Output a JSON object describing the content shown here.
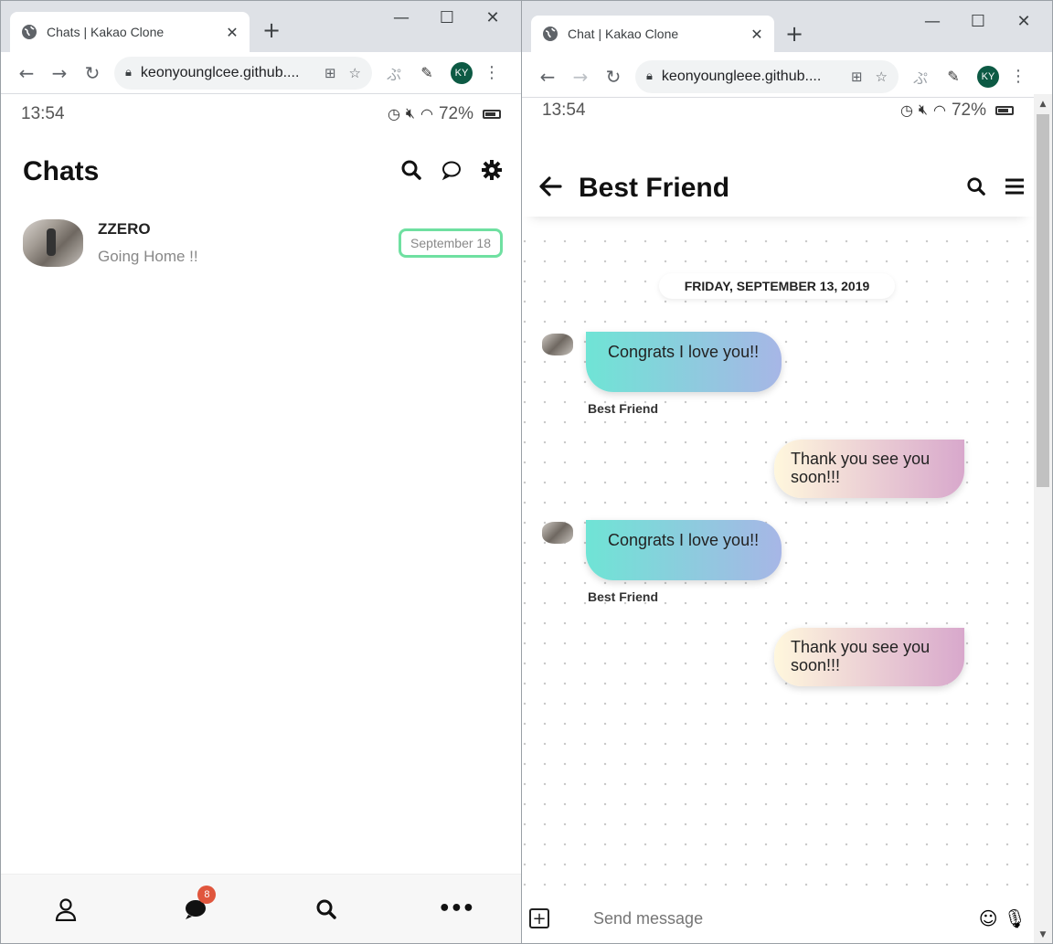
{
  "left_window": {
    "tab_title": "Chats | Kakao Clone",
    "url": "keonyounglcee.github....",
    "profile_initials": "KY",
    "status": {
      "time": "13:54",
      "battery": "72%"
    },
    "header_title": "Chats",
    "chat_list": [
      {
        "name": "ZZERO",
        "preview": "Going Home !!",
        "date": "September 18"
      }
    ],
    "tabbar": {
      "badge_count": "8"
    }
  },
  "right_window": {
    "tab_title": "Chat | Kakao Clone",
    "url": "keonyoungleee.github....",
    "profile_initials": "KY",
    "status": {
      "time": "13:54",
      "battery": "72%"
    },
    "header_title": "Best Friend",
    "date_divider": "FRIDAY, SEPTEMBER 13, 2019",
    "messages": [
      {
        "dir": "in",
        "text": "Congrats I love you!!",
        "sender": "Best Friend"
      },
      {
        "dir": "out",
        "text": "Thank you see you soon!!!"
      },
      {
        "dir": "in",
        "text": "Congrats I love you!!",
        "sender": "Best Friend"
      },
      {
        "dir": "out",
        "text": "Thank you see you soon!!!"
      }
    ],
    "composer_placeholder": "Send message"
  },
  "colors": {
    "date_pill_border": "#6fe0a1",
    "in_bubble_start": "#6fe4d5",
    "in_bubble_end": "#a7b6e6",
    "out_bubble_start": "#fff7dd",
    "out_bubble_end": "#d8a8cc",
    "badge": "#e0563d"
  }
}
